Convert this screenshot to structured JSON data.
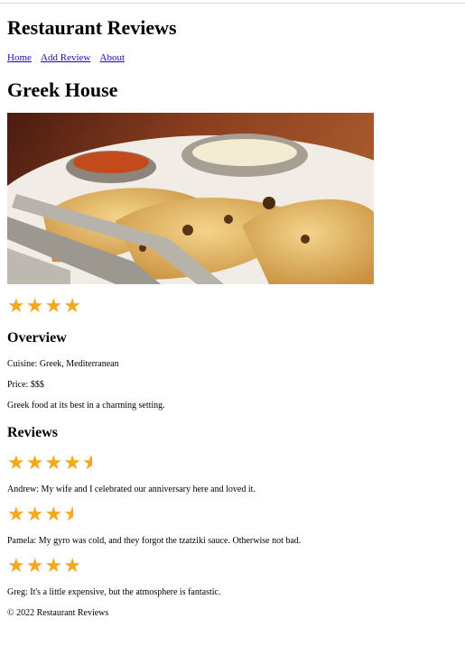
{
  "header": {
    "title": "Restaurant Reviews"
  },
  "nav": {
    "items": [
      "Home",
      "Add Review",
      "About"
    ]
  },
  "restaurant": {
    "name": "Greek House",
    "rating": 4,
    "rating_max": 5,
    "overview_heading": "Overview",
    "cuisine": "Cuisine: Greek, Mediterranean",
    "price": "Price: $$$",
    "description": "Greek food at its best in a charming setting."
  },
  "reviews": {
    "heading": "Reviews",
    "items": [
      {
        "rating": 4.5,
        "text": "Andrew: My wife and I celebrated our anniversary here and loved it."
      },
      {
        "rating": 3.5,
        "text": "Pamela: My gyro was cold, and they forgot the tzatziki sauce. Otherwise not bad."
      },
      {
        "rating": 4,
        "text": "Greg: It's a little expensive, but the atmosphere is fantastic."
      }
    ]
  },
  "footer": {
    "text": "© 2022 Restaurant Reviews"
  },
  "colors": {
    "star": "#f4a81d",
    "link": "#1a0dab"
  }
}
